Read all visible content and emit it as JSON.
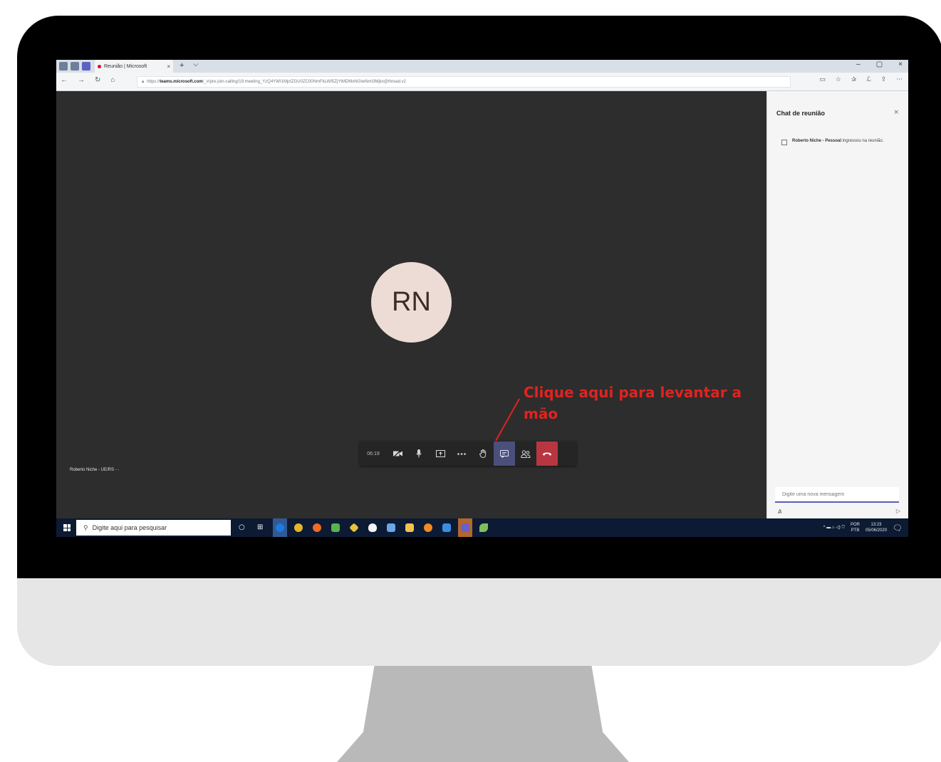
{
  "browser": {
    "tab_title": "Reunião | Microsoft",
    "tab_close": "×",
    "new_tab": "+",
    "tab_menu": "⌵",
    "window_controls": {
      "minimize": "–",
      "maximize": "▢",
      "close": "×"
    },
    "nav": {
      "back": "←",
      "forward": "→",
      "refresh": "↻",
      "home": "⌂"
    },
    "url_prefix": "https://",
    "url_host": "teams.microsoft.com",
    "url_path": "/_#/pre-join-calling/19:meeting_YzQ4YWI1MjctZGU0ZC00NmFkLWI5ZjYtMDMxNGIwNmI3Mjkx@thread.v2",
    "tools": [
      "▭",
      "☆",
      "✰",
      "ℒ",
      "⇪",
      "···"
    ]
  },
  "meeting": {
    "avatar_initials": "RN",
    "participant_name": "Roberto Niche - UE/RS ···",
    "timer": "06:19"
  },
  "annotation": {
    "text": "Clique aqui para levantar a mão",
    "color": "#e1231f"
  },
  "chat": {
    "title": "Chat de reunião",
    "close": "×",
    "message_name": "Roberto Niche - Pessoal",
    "message_text": " ingressou na reunião.",
    "input_placeholder": "Digite uma nova mensagem",
    "format_icon": "A̷",
    "send_icon": "▷"
  },
  "taskbar": {
    "search_placeholder": "Digite aqui para pesquisar",
    "tray_lang_top": "POR",
    "tray_lang_bottom": "PTB",
    "tray_time": "13:23",
    "tray_date": "05/06/2020",
    "tray_icons": "^  ▬  ⌂  ◁)  ⛉"
  },
  "colors": {
    "meeting_bg": "#2d2d2d",
    "chat_active": "#4b4f7c",
    "hangup": "#b8363f",
    "taskbar": "#0c1a33"
  }
}
